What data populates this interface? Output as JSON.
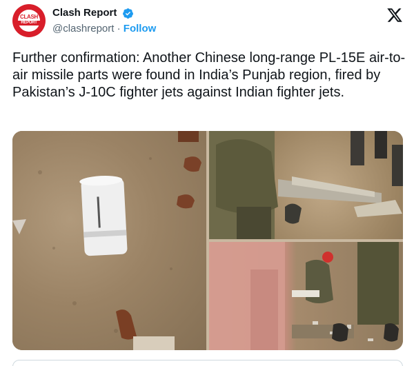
{
  "account": {
    "display_name": "Clash Report",
    "handle": "@clashreport",
    "separator": "·",
    "follow_label": "Follow",
    "avatar_text": "CLASH",
    "avatar_subtext": "REPORT",
    "brand_color": "#d81e2a",
    "verified_color": "#1d9bf0"
  },
  "tweet": {
    "text": "Further confirmation: Another Chinese long-range PL-15E air-to-air missile parts were found in India’s Punjab region, fired by Pakistan’s J-10C fighter jets against Indian fighter jets."
  },
  "media": {
    "image_count": 3,
    "images": [
      {
        "desc_icon": "photo-icon"
      },
      {
        "desc_icon": "photo-icon"
      },
      {
        "desc_icon": "photo-icon"
      }
    ]
  },
  "icons": {
    "platform": "x-logo-icon",
    "verified": "verified-badge-icon"
  }
}
